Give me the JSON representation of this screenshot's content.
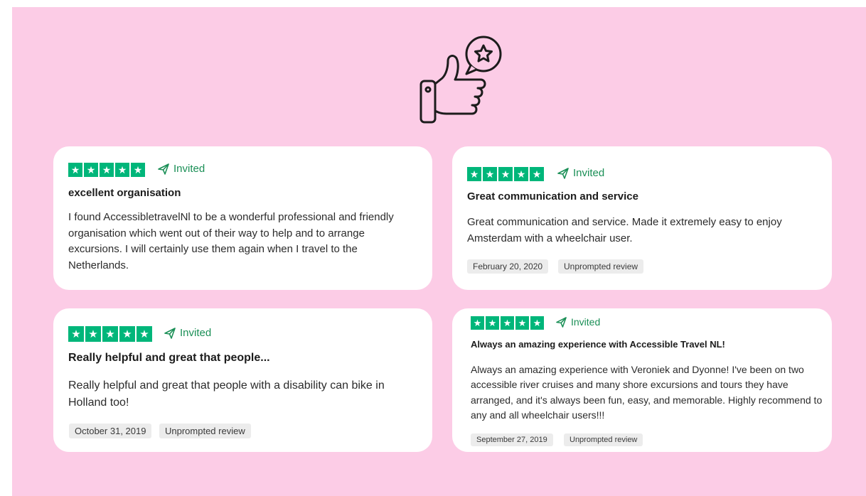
{
  "colors": {
    "background": "#fccce6",
    "card": "#ffffff",
    "star_green": "#00b67a",
    "invited_green": "#1a8f56"
  },
  "hero": {
    "icon": "thumbs-up-with-star-speech-bubble-icon"
  },
  "reviews": [
    {
      "rating": 5,
      "badge": "Invited",
      "title": "excellent organisation",
      "body": "I found AccessibletravelNl to be a wonderful professional and friendly organisation which went out of their way to help and to arrange excursions. I will certainly use them again when I travel to the Netherlands."
    },
    {
      "rating": 5,
      "badge": "Invited",
      "title": "Great communication and service",
      "body": "Great communication and service. Made it extremely easy to enjoy Amsterdam with a wheelchair user.",
      "date": "February 20, 2020",
      "tag": "Unprompted review"
    },
    {
      "rating": 5,
      "badge": "Invited",
      "title": "Really helpful and great that people...",
      "body": "Really helpful and great that people with a disability can bike in Holland too!",
      "date": "October 31, 2019",
      "tag": "Unprompted review"
    },
    {
      "rating": 5,
      "badge": "Invited",
      "title": "Always an amazing experience with Accessible Travel NL!",
      "body": "Always an amazing experience with Veroniek and Dyonne! I've been on two accessible river cruises and many shore excursions and tours they have arranged, and it's always been fun, easy, and memorable. Highly recommend to any and all wheelchair users!!!",
      "date": "September 27, 2019",
      "tag": "Unprompted review"
    }
  ]
}
